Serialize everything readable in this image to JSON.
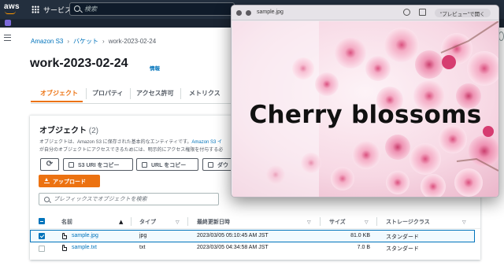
{
  "topnav": {
    "logo": "aws",
    "services": "サービス",
    "search_placeholder": "検索"
  },
  "breadcrumb": {
    "items": [
      "Amazon S3",
      "バケット",
      "work-2023-02-24"
    ]
  },
  "page": {
    "title": "work-2023-02-24",
    "info": "情報"
  },
  "tabs": [
    "オブジェクト",
    "プロパティ",
    "アクセス許可",
    "メトリクス"
  ],
  "objects_panel": {
    "title": "オブジェクト",
    "count": "(2)",
    "desc_line1_before": "オブジェクトは、Amazon S3 に保存された基本的なエンティティです。",
    "desc_line1_link": "Amazon S3 イ",
    "desc_line2": "が自分のオブジェクトにアクセスできるためには、明示的にアクセス権限を付与する必",
    "buttons": {
      "copy_s3_uri": "S3 URI をコピー",
      "copy_url": "URL をコピー",
      "download": "ダウ",
      "upload": "アップロード"
    },
    "filter_placeholder": "プレフィックスでオブジェクトを検索",
    "columns": [
      "名前",
      "タイプ",
      "最終更新日時",
      "サイズ",
      "ストレージクラス"
    ],
    "rows": [
      {
        "name": "sample.jpg",
        "type": "jpg",
        "modified": "2023/03/05 05:10:45 AM JST",
        "size": "81.0 KB",
        "storage": "スタンダード",
        "selected": true
      },
      {
        "name": "sample.txt",
        "type": "txt",
        "modified": "2023/03/05 04:34:58 AM JST",
        "size": "7.0 B",
        "storage": "スタンダード",
        "selected": false
      }
    ]
  },
  "quicklook": {
    "filename": "sample.jpg",
    "open_with": "\"プレビュー\"で開く",
    "image_caption": "Cherry blossoms"
  },
  "colors": {
    "aws_orange": "#ec7211",
    "link_blue": "#0073bb",
    "nav_dark": "#232f3e"
  }
}
